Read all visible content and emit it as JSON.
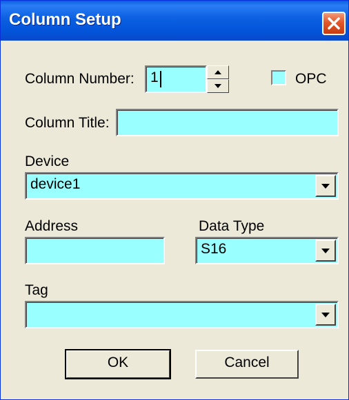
{
  "window": {
    "title": "Column Setup"
  },
  "column_number": {
    "label": "Column Number:",
    "value": "1"
  },
  "opc": {
    "label": "OPC",
    "checked": false
  },
  "column_title": {
    "label": "Column Title:",
    "value": ""
  },
  "device": {
    "label": "Device",
    "value": "device1"
  },
  "address": {
    "label": "Address",
    "value": ""
  },
  "data_type": {
    "label": "Data Type",
    "value": "S16"
  },
  "tag": {
    "label": "Tag",
    "value": ""
  },
  "buttons": {
    "ok": "OK",
    "cancel": "Cancel"
  },
  "colors": {
    "field_bg": "#99ffff",
    "title_bar": "#0a5ee0",
    "dialog_bg": "#ece9d8",
    "close": "#e2582a"
  }
}
